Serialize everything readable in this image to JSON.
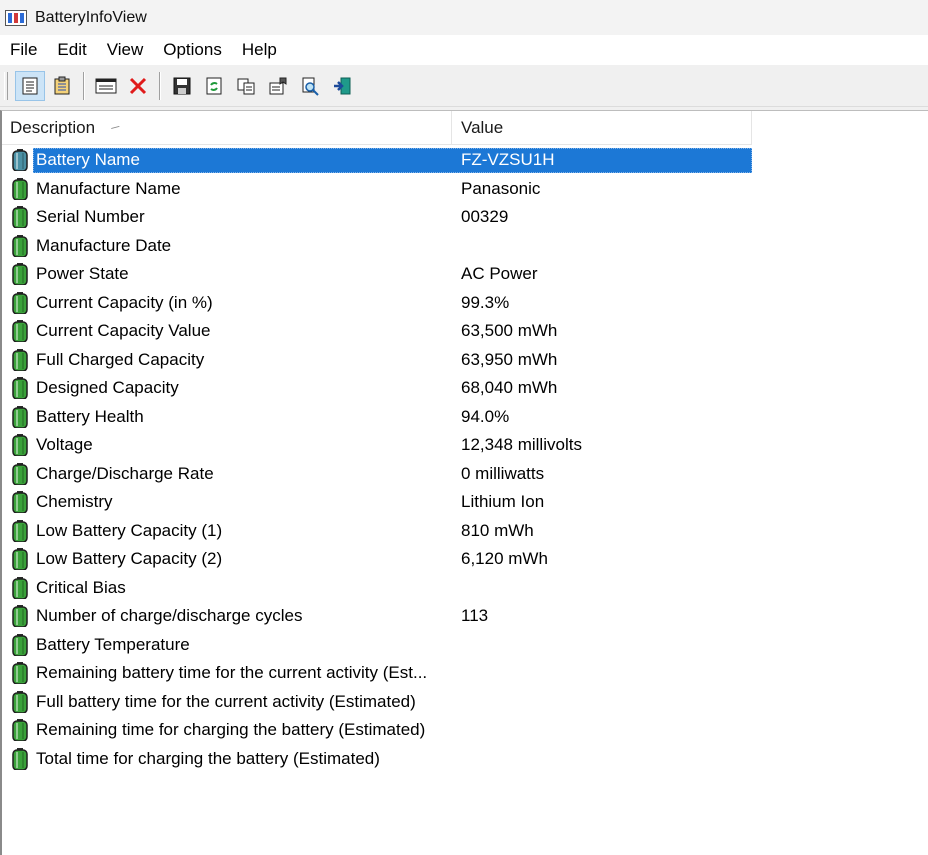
{
  "window": {
    "title": "BatteryInfoView"
  },
  "menu": [
    "File",
    "Edit",
    "View",
    "Options",
    "Help"
  ],
  "toolbar": {
    "buttons": [
      {
        "name": "html-report-icon",
        "pressed": true
      },
      {
        "name": "text-report-icon",
        "pressed": false
      },
      {
        "name": "window-icon",
        "pressed": false
      },
      {
        "name": "close-red-x-icon",
        "pressed": false
      },
      {
        "name": "save-icon",
        "pressed": false
      },
      {
        "name": "refresh-icon",
        "pressed": false
      },
      {
        "name": "copy-icon",
        "pressed": false
      },
      {
        "name": "properties-icon",
        "pressed": false
      },
      {
        "name": "find-icon",
        "pressed": false
      },
      {
        "name": "exit-icon",
        "pressed": false
      }
    ]
  },
  "columns": {
    "description": "Description",
    "value": "Value"
  },
  "rows": [
    {
      "description": "Battery Name",
      "value": "FZ-VZSU1H",
      "selected": true
    },
    {
      "description": "Manufacture Name",
      "value": "Panasonic"
    },
    {
      "description": "Serial Number",
      "value": "00329"
    },
    {
      "description": "Manufacture Date",
      "value": ""
    },
    {
      "description": "Power State",
      "value": "AC Power"
    },
    {
      "description": "Current Capacity (in %)",
      "value": "99.3%"
    },
    {
      "description": "Current Capacity Value",
      "value": "63,500 mWh"
    },
    {
      "description": "Full Charged Capacity",
      "value": "63,950 mWh"
    },
    {
      "description": "Designed Capacity",
      "value": "68,040 mWh"
    },
    {
      "description": "Battery Health",
      "value": "94.0%"
    },
    {
      "description": "Voltage",
      "value": "12,348 millivolts"
    },
    {
      "description": "Charge/Discharge Rate",
      "value": "0 milliwatts"
    },
    {
      "description": "Chemistry",
      "value": "Lithium Ion"
    },
    {
      "description": "Low Battery Capacity (1)",
      "value": "810 mWh"
    },
    {
      "description": "Low Battery Capacity (2)",
      "value": "6,120 mWh"
    },
    {
      "description": "Critical Bias",
      "value": ""
    },
    {
      "description": "Number of charge/discharge cycles",
      "value": "113"
    },
    {
      "description": "Battery Temperature",
      "value": ""
    },
    {
      "description": "Remaining battery time for the current activity (Est...",
      "value": ""
    },
    {
      "description": "Full battery time for the current activity (Estimated)",
      "value": ""
    },
    {
      "description": "Remaining time for charging the battery (Estimated)",
      "value": ""
    },
    {
      "description": "Total  time for charging the battery (Estimated)",
      "value": ""
    }
  ],
  "colors": {
    "selection": "#1c78d6",
    "battery_green": "#3aa23a",
    "battery_selected": "#4a90a4"
  }
}
